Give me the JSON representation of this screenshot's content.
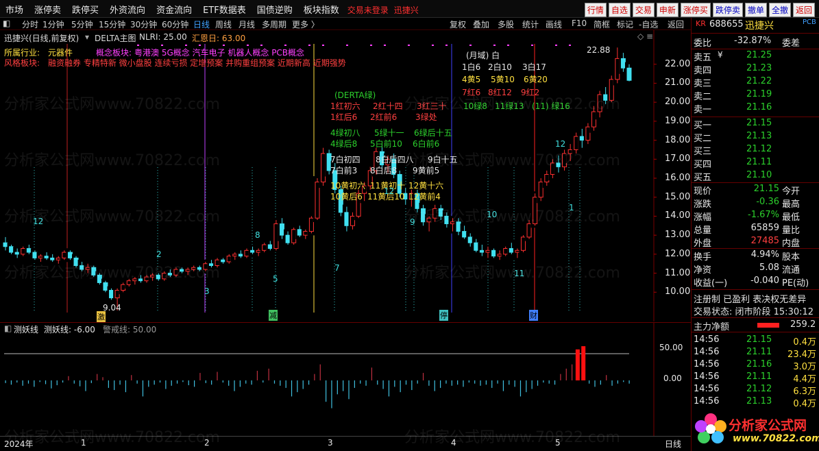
{
  "menu": {
    "items": [
      "市场",
      "涨停卖",
      "跌停买",
      "外资流向",
      "资金流向",
      "ETF数据表",
      "国债逆购",
      "板块指数"
    ],
    "warning": "交易未登录",
    "stock_name_top": "迅捷兴",
    "right_buttons": [
      "行情",
      "自选",
      "交易",
      "申新",
      "涨停买",
      "跌停卖",
      "撤单",
      "全撤",
      "返回"
    ]
  },
  "periods": [
    "分时",
    "1分钟",
    "5分钟",
    "15分钟",
    "30分钟",
    "60分钟",
    "日线",
    "周线",
    "月线",
    "多周期",
    "更多 〉"
  ],
  "tools": [
    "复权",
    "叠加",
    "多股",
    "统计",
    "画线",
    "F10",
    "简框",
    "标记",
    "-自选",
    "返回"
  ],
  "chart_header": {
    "name": "迅捷兴(日线,前复权)",
    "indicator": "DELTA主图",
    "nlri": "NLRI: 25.00",
    "huien": "汇恩日: 63.00"
  },
  "industry": {
    "label": "所属行业:",
    "value": "元器件"
  },
  "concept": {
    "label": "概念板块:",
    "value": "粤港澳 5G概念 汽车电子 机器人概念 PCB概念"
  },
  "style": {
    "label": "风格板块:",
    "value": "融资融券 专精特新 微小盘股 连续亏损 定增预案 并购重组预案 近期新高 近期强势"
  },
  "annotations": {
    "month_domain": "(月域)  白",
    "white1": [
      "1白6",
      "2白10",
      "3白17"
    ],
    "yellow1": [
      "4黄5",
      "5黄10",
      "6黄20"
    ],
    "red1": [
      "7红6",
      "8红12",
      "9红2"
    ],
    "green1": [
      "10绿8",
      "11绿13",
      "(11)  绿16"
    ],
    "derta": "(DERTA绿)",
    "red2a": [
      "1红初六",
      "2红十四",
      "3红三十"
    ],
    "red2b": [
      "1红后6",
      "2红前6",
      "3绿处"
    ],
    "green2a": [
      "4绿初八",
      "5绿十一",
      "6绿后十五"
    ],
    "green2b": [
      "4绿后8",
      "5白前10",
      "6白前6"
    ],
    "white2a": [
      "7白初四",
      "8白后四八",
      "9白十五"
    ],
    "white2b": [
      "7白前3",
      "8白后8",
      "9黄前5"
    ],
    "yellow2a": [
      "10黄初六",
      "11黄初十",
      "12黄十六"
    ],
    "yellow2b": [
      "10黄后6",
      "11黄后10",
      "12黄前4"
    ],
    "high_label": "22.88",
    "low_label": "9.04",
    "markers": [
      "激",
      "减",
      "停",
      "财"
    ],
    "cycle_numbers": [
      "12",
      "2",
      "3",
      "8",
      "5",
      "7",
      "12",
      "9",
      "10",
      "11",
      "1",
      "12",
      "1"
    ]
  },
  "price_axis": [
    "22.00",
    "21.00",
    "20.00",
    "19.00",
    "18.00",
    "17.00",
    "16.00",
    "15.00",
    "14.00",
    "13.00",
    "12.00",
    "11.00",
    "10.00"
  ],
  "sub_indicator": {
    "name": "测妖线",
    "value_label": "测妖线: -6.00",
    "warn_label": "警戒线: 50.00",
    "axis": [
      "50.00",
      "0.00"
    ]
  },
  "date_axis": [
    "2024年",
    "1",
    "2",
    "3",
    "4",
    "5",
    "日线"
  ],
  "watermark": "分析家公式网www.70822.com",
  "chart_data": {
    "type": "candlestick",
    "ylim": [
      9,
      23
    ],
    "candles": [
      [
        12.6,
        12.9,
        12.2,
        12.4
      ],
      [
        12.4,
        12.5,
        12.0,
        12.1
      ],
      [
        12.1,
        12.3,
        11.8,
        12.0
      ],
      [
        12.0,
        12.4,
        11.9,
        12.3
      ],
      [
        12.3,
        12.5,
        12.0,
        12.1
      ],
      [
        12.1,
        12.2,
        11.7,
        11.8
      ],
      [
        11.8,
        12.0,
        11.6,
        11.9
      ],
      [
        11.9,
        12.1,
        11.7,
        11.8
      ],
      [
        11.8,
        12.0,
        11.6,
        11.7
      ],
      [
        11.7,
        11.9,
        11.5,
        11.8
      ],
      [
        11.8,
        12.2,
        11.7,
        12.1
      ],
      [
        12.1,
        12.2,
        11.7,
        11.8
      ],
      [
        11.8,
        11.9,
        11.3,
        11.4
      ],
      [
        11.4,
        11.6,
        11.1,
        11.2
      ],
      [
        11.2,
        11.5,
        11.0,
        11.3
      ],
      [
        11.3,
        11.4,
        10.8,
        10.9
      ],
      [
        10.9,
        11.0,
        10.4,
        10.5
      ],
      [
        10.5,
        10.6,
        10.0,
        10.1
      ],
      [
        10.1,
        10.2,
        9.6,
        9.7
      ],
      [
        9.7,
        10.2,
        9.04,
        10.1
      ],
      [
        10.1,
        10.5,
        10.0,
        10.4
      ],
      [
        10.4,
        10.7,
        10.3,
        10.6
      ],
      [
        10.6,
        10.8,
        10.4,
        10.7
      ],
      [
        10.7,
        10.9,
        10.5,
        10.6
      ],
      [
        10.6,
        10.9,
        10.5,
        10.8
      ],
      [
        10.8,
        11.0,
        10.6,
        10.9
      ],
      [
        10.9,
        11.0,
        10.6,
        10.7
      ],
      [
        10.7,
        11.1,
        10.6,
        11.0
      ],
      [
        11.0,
        11.2,
        10.8,
        10.9
      ],
      [
        10.9,
        11.3,
        10.8,
        11.2
      ],
      [
        11.2,
        11.3,
        11.0,
        11.1
      ],
      [
        11.1,
        11.3,
        10.9,
        11.2
      ],
      [
        11.2,
        11.4,
        11.1,
        11.3
      ],
      [
        11.3,
        11.4,
        11.1,
        11.2
      ],
      [
        11.2,
        11.6,
        11.1,
        11.5
      ],
      [
        11.5,
        11.7,
        11.3,
        11.4
      ],
      [
        11.4,
        11.8,
        11.3,
        11.7
      ],
      [
        11.7,
        11.8,
        11.5,
        11.6
      ],
      [
        11.6,
        12.0,
        11.5,
        11.9
      ],
      [
        11.9,
        12.1,
        11.7,
        12.0
      ],
      [
        12.0,
        12.2,
        11.8,
        11.9
      ],
      [
        11.9,
        12.3,
        11.8,
        12.2
      ],
      [
        12.2,
        12.4,
        12.0,
        12.1
      ],
      [
        12.1,
        12.3,
        11.9,
        12.2
      ],
      [
        12.2,
        12.6,
        12.1,
        12.5
      ],
      [
        12.5,
        12.7,
        12.2,
        12.3
      ],
      [
        12.3,
        13.8,
        12.2,
        13.6
      ],
      [
        13.6,
        13.9,
        12.8,
        13.0
      ],
      [
        13.0,
        13.2,
        12.5,
        12.6
      ],
      [
        12.6,
        13.4,
        12.5,
        13.3
      ],
      [
        13.3,
        13.5,
        12.9,
        13.0
      ],
      [
        13.0,
        13.3,
        12.8,
        13.2
      ],
      [
        13.2,
        14.0,
        13.1,
        13.9
      ],
      [
        13.9,
        16.0,
        13.8,
        15.8
      ],
      [
        15.8,
        17.6,
        15.6,
        17.3
      ],
      [
        17.3,
        17.5,
        16.2,
        16.4
      ],
      [
        16.4,
        16.8,
        15.2,
        15.4
      ],
      [
        15.4,
        15.6,
        14.0,
        14.2
      ],
      [
        14.2,
        14.5,
        13.2,
        13.5
      ],
      [
        13.5,
        14.2,
        13.3,
        14.0
      ],
      [
        14.0,
        15.4,
        13.9,
        15.2
      ],
      [
        15.2,
        15.8,
        14.8,
        15.6
      ],
      [
        15.6,
        16.6,
        15.4,
        16.4
      ],
      [
        16.4,
        17.6,
        16.2,
        17.4
      ],
      [
        17.4,
        17.8,
        16.5,
        16.7
      ],
      [
        16.7,
        17.2,
        16.3,
        17.0
      ],
      [
        17.0,
        17.3,
        16.0,
        16.2
      ],
      [
        16.2,
        16.4,
        15.0,
        15.2
      ],
      [
        15.2,
        15.5,
        14.6,
        14.9
      ],
      [
        14.9,
        15.4,
        14.5,
        15.2
      ],
      [
        15.2,
        15.4,
        14.2,
        14.4
      ],
      [
        14.4,
        14.6,
        13.5,
        13.7
      ],
      [
        13.7,
        14.0,
        13.2,
        13.9
      ],
      [
        13.9,
        14.6,
        13.7,
        14.4
      ],
      [
        14.4,
        14.6,
        13.8,
        14.0
      ],
      [
        14.0,
        14.2,
        13.4,
        13.6
      ],
      [
        13.6,
        13.9,
        13.2,
        13.7
      ],
      [
        13.7,
        13.9,
        13.0,
        13.2
      ],
      [
        13.2,
        13.5,
        12.8,
        12.9
      ],
      [
        12.9,
        13.1,
        12.4,
        12.6
      ],
      [
        12.6,
        12.8,
        12.1,
        12.2
      ],
      [
        12.2,
        12.5,
        11.9,
        12.1
      ],
      [
        12.1,
        12.4,
        11.8,
        12.2
      ],
      [
        12.2,
        12.3,
        11.8,
        11.9
      ],
      [
        11.9,
        12.2,
        11.7,
        12.0
      ],
      [
        12.0,
        12.4,
        11.9,
        12.3
      ],
      [
        12.3,
        12.6,
        12.0,
        12.1
      ],
      [
        12.1,
        12.3,
        11.8,
        12.2
      ],
      [
        12.2,
        13.0,
        12.1,
        12.9
      ],
      [
        12.9,
        13.8,
        12.8,
        13.6
      ],
      [
        13.6,
        15.2,
        13.5,
        15.0
      ],
      [
        15.0,
        16.0,
        14.8,
        15.8
      ],
      [
        15.8,
        16.4,
        15.6,
        16.2
      ],
      [
        16.2,
        17.0,
        16.0,
        16.8
      ],
      [
        16.8,
        17.2,
        16.3,
        16.6
      ],
      [
        16.6,
        17.5,
        16.4,
        17.3
      ],
      [
        17.3,
        17.8,
        16.9,
        17.5
      ],
      [
        17.5,
        18.4,
        17.3,
        18.2
      ],
      [
        18.2,
        18.6,
        17.6,
        18.0
      ],
      [
        18.0,
        18.9,
        17.8,
        18.7
      ],
      [
        18.7,
        19.8,
        18.5,
        19.5
      ],
      [
        19.5,
        20.6,
        19.2,
        20.4
      ],
      [
        20.4,
        20.8,
        19.9,
        20.1
      ],
      [
        20.1,
        21.4,
        20.0,
        21.2
      ],
      [
        21.2,
        22.88,
        21.0,
        22.3
      ],
      [
        22.3,
        22.6,
        21.6,
        21.8
      ],
      [
        21.8,
        22.0,
        21.1,
        21.15
      ]
    ],
    "sub_values": [
      -5,
      -8,
      -4,
      -10,
      -6,
      -12,
      -3,
      -7,
      -15,
      -9,
      -4,
      8,
      -6,
      -11,
      -20,
      -5,
      12,
      6,
      -14,
      -18,
      -8,
      -22,
      10,
      -6,
      -30,
      -12,
      -8,
      -4,
      -16,
      -10,
      -6,
      -3,
      -9,
      -12,
      14,
      -5,
      -8,
      16,
      -4,
      -10,
      -20,
      -12,
      -6,
      -8,
      18,
      -4,
      22,
      -6,
      -10,
      -14,
      -30,
      -22,
      -16,
      -8,
      12,
      30,
      -40,
      -52,
      -26,
      -20,
      -35,
      -14,
      -6,
      -10,
      24,
      -8,
      -16,
      -30,
      -12,
      -22,
      -8,
      -18,
      -6,
      14,
      -10,
      -20,
      -14,
      -6,
      -10,
      -8,
      -12,
      -4,
      -6,
      -10,
      -8,
      -14,
      -6,
      -20,
      -8,
      -12,
      -30,
      -22,
      -16,
      -10,
      -4,
      -6,
      -8,
      12,
      22,
      30,
      58,
      64,
      -6,
      -12,
      -8,
      10,
      -10,
      -6,
      -3,
      -6
    ]
  },
  "quote": {
    "code": "688655",
    "name": "迅捷兴",
    "pcb_tag": "PCB",
    "weibi_label": "委比",
    "weibi": "-32.87%",
    "weicha_label": "委差",
    "sell": [
      {
        "label": "卖五",
        "price": "21.25"
      },
      {
        "label": "卖四",
        "price": "21.23"
      },
      {
        "label": "卖三",
        "price": "21.22"
      },
      {
        "label": "卖二",
        "price": "21.19"
      },
      {
        "label": "卖一",
        "price": "21.16"
      }
    ],
    "buy": [
      {
        "label": "买一",
        "price": "21.15"
      },
      {
        "label": "买二",
        "price": "21.13"
      },
      {
        "label": "买三",
        "price": "21.12"
      },
      {
        "label": "买四",
        "price": "21.11"
      },
      {
        "label": "买五",
        "price": "21.10"
      }
    ],
    "stats": [
      {
        "l1": "现价",
        "v1": "21.15",
        "l2": "今开",
        "c": "g"
      },
      {
        "l1": "涨跌",
        "v1": "-0.36",
        "l2": "最高",
        "c": "g"
      },
      {
        "l1": "涨幅",
        "v1": "-1.67%",
        "l2": "最低",
        "c": "g"
      },
      {
        "l1": "总量",
        "v1": "65859",
        "l2": "量比",
        "c": "w"
      },
      {
        "l1": "外盘",
        "v1": "27485",
        "l2": "内盘",
        "c": "rd"
      }
    ],
    "stats2": [
      {
        "l1": "换手",
        "v1": "4.94%",
        "l2": "股本"
      },
      {
        "l1": "净资",
        "v1": "5.08",
        "l2": "流通"
      },
      {
        "l1": "收益(一)",
        "v1": "-0.040",
        "l2": "PE(动)"
      }
    ],
    "tags": "注册制 已盈利 表决权无差异",
    "trade_state": "交易状态: 闭市阶段 15:30:12",
    "main_flow_label": "主力净额",
    "main_flow_value": "259.2",
    "ticks": [
      {
        "t": "14:56",
        "p": "21.15",
        "v": "0.4万"
      },
      {
        "t": "14:56",
        "p": "21.11",
        "v": "23.4万"
      },
      {
        "t": "14:56",
        "p": "21.16",
        "v": "3.0万"
      },
      {
        "t": "14:56",
        "p": "21.11",
        "v": "4.4万"
      },
      {
        "t": "14:56",
        "p": "21.12",
        "v": "6.3万"
      },
      {
        "t": "14:56",
        "p": "21.13",
        "v": "0.4万"
      }
    ],
    "logo_text": "分析家公式网",
    "logo_url": "www.70822.com"
  }
}
